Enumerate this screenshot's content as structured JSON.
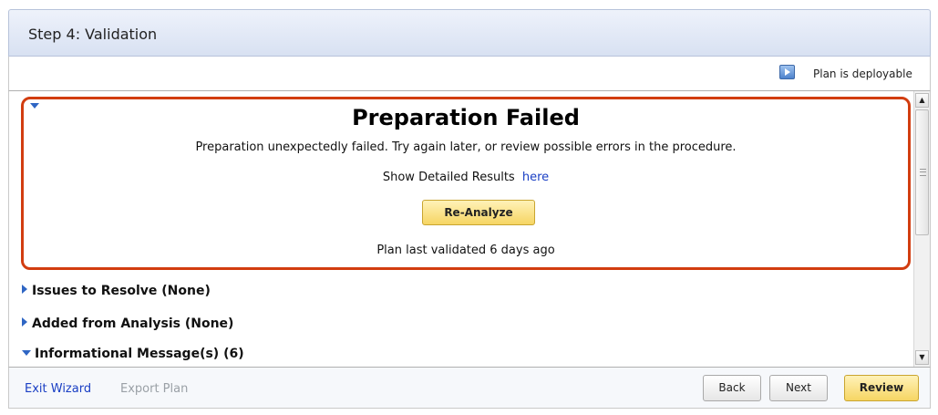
{
  "header": {
    "title": "Step 4: Validation"
  },
  "status": {
    "deploy_label": "Plan is deployable",
    "icon": "deploy-plan-icon"
  },
  "result_panel": {
    "title": "Preparation Failed",
    "message": "Preparation unexpectedly failed. Try again later, or review possible errors in the procedure.",
    "detail_prefix": "Show Detailed Results",
    "detail_link": "here",
    "reanalyze_label": "Re-Analyze",
    "last_validated": "Plan last validated 6 days ago",
    "border_color": "#d23d10"
  },
  "sections": [
    {
      "label": "Issues to Resolve (None)",
      "expanded": false
    },
    {
      "label": "Added from Analysis (None)",
      "expanded": false
    },
    {
      "label": "Informational Message(s) (6)",
      "expanded": true
    }
  ],
  "footer": {
    "exit_label": "Exit Wizard",
    "export_label": "Export Plan",
    "back_label": "Back",
    "next_label": "Next",
    "review_label": "Review"
  },
  "colors": {
    "accent_button": "#f6d563",
    "link": "#1a3fc4",
    "header_bg": "#d8e1f2"
  }
}
